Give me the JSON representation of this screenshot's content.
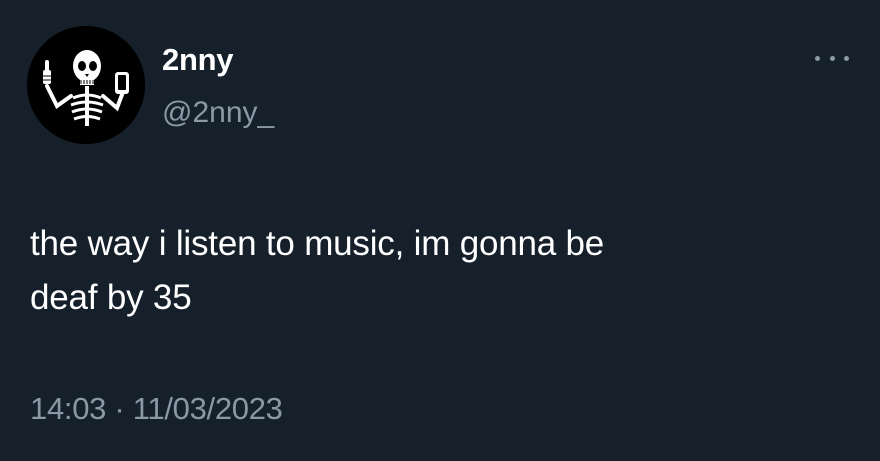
{
  "author": {
    "display_name": "2nny",
    "handle": "@2nny_",
    "avatar_icon": "skeleton-avatar-icon"
  },
  "tweet": {
    "text": "the way i listen to music, im gonna be\ndeaf by 35",
    "time": "14:03",
    "separator": "·",
    "date": "11/03/2023"
  },
  "actions": {
    "more_icon": "more-options-icon"
  },
  "colors": {
    "background": "#15202b",
    "primary_text": "#ffffff",
    "secondary_text": "#8b98a5"
  }
}
